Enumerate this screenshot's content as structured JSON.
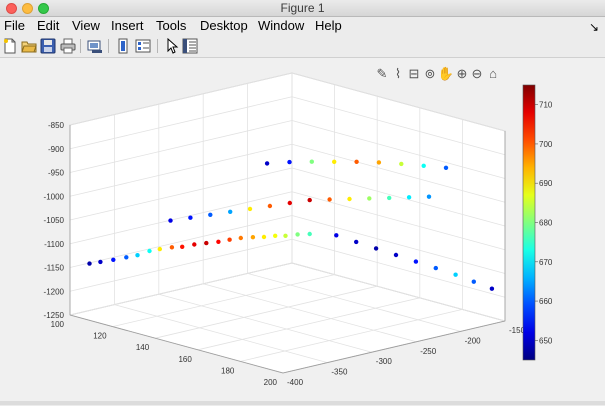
{
  "window": {
    "title": "Figure 1"
  },
  "menu": [
    "File",
    "Edit",
    "View",
    "Insert",
    "Tools",
    "Desktop",
    "Window",
    "Help"
  ],
  "menu_overflow_icon": "arrow-icon",
  "toolbar": {
    "buttons": [
      "new-figure-icon",
      "open-file-icon",
      "save-icon",
      "print-icon",
      "link-plot-icon",
      "insert-colorbar-icon",
      "insert-legend-icon",
      "pointer-icon",
      "property-inspector-icon"
    ]
  },
  "axes_toolbar": [
    "brush-icon",
    "data-tips-icon",
    "export-icon",
    "rotate-3d-icon",
    "pan-icon",
    "zoom-in-icon",
    "zoom-out-icon",
    "home-icon"
  ],
  "chart_data": {
    "type": "scatter",
    "dimensions": "3d",
    "xlim": [
      100,
      200
    ],
    "ylim": [
      -400,
      -150
    ],
    "zlim": [
      -1250,
      -850
    ],
    "x_ticks": [
      "100",
      "120",
      "140",
      "160",
      "180",
      "200"
    ],
    "y_ticks": [
      "-400",
      "-350",
      "-300",
      "-250",
      "-200",
      "-150"
    ],
    "z_ticks": [
      "-850",
      "-900",
      "-950",
      "-1000",
      "-1050",
      "-1100",
      "-1150",
      "-1200",
      "-1250"
    ],
    "colorbar": {
      "ticks": [
        "710",
        "700",
        "690",
        "680",
        "670",
        "660",
        "650"
      ],
      "range": [
        645,
        715
      ],
      "colormap": "jet"
    },
    "grid": true,
    "series": [
      {
        "x": [
          105,
          108,
          112,
          116,
          120,
          124,
          128,
          132,
          136,
          140,
          144,
          148,
          152,
          156,
          160,
          164,
          168,
          172,
          176,
          180
        ],
        "y": [
          -390,
          -385,
          -380,
          -375,
          -372,
          -368,
          -366,
          -362,
          -360,
          -356,
          -352,
          -348,
          -345,
          -342,
          -338,
          -335,
          -332,
          -330,
          -326,
          -322
        ],
        "z": [
          -1140,
          -1135,
          -1128,
          -1120,
          -1112,
          -1100,
          -1092,
          -1085,
          -1080,
          -1072,
          -1066,
          -1060,
          -1052,
          -1045,
          -1040,
          -1036,
          -1030,
          -1026,
          -1020,
          -1016
        ],
        "c": [
          648,
          650,
          655,
          660,
          668,
          672,
          690,
          700,
          705,
          708,
          710,
          706,
          702,
          698,
          695,
          690,
          688,
          685,
          680,
          676
        ]
      },
      {
        "x": [
          118,
          124,
          130,
          136,
          142,
          148,
          154,
          160,
          166,
          172,
          178,
          184,
          190,
          196
        ],
        "y": [
          -330,
          -322,
          -314,
          -306,
          -298,
          -290,
          -282,
          -274,
          -266,
          -258,
          -250,
          -242,
          -234,
          -226
        ],
        "z": [
          -1060,
          -1050,
          -1040,
          -1030,
          -1020,
          -1010,
          -1000,
          -990,
          -985,
          -980,
          -975,
          -970,
          -965,
          -960
        ],
        "c": [
          652,
          655,
          660,
          665,
          690,
          700,
          708,
          710,
          700,
          690,
          682,
          676,
          670,
          664
        ]
      },
      {
        "x": [
          130,
          138,
          146,
          154,
          162,
          170,
          178,
          186,
          194
        ],
        "y": [
          -250,
          -244,
          -238,
          -232,
          -226,
          -220,
          -214,
          -208,
          -202
        ],
        "z": [
          -960,
          -950,
          -942,
          -935,
          -928,
          -922,
          -918,
          -915,
          -912
        ],
        "c": [
          650,
          655,
          680,
          690,
          700,
          695,
          685,
          672,
          660
        ]
      },
      {
        "x": [
          150,
          156,
          162,
          168,
          174,
          180,
          186,
          192,
          198
        ],
        "y": [
          -220,
          -212,
          -204,
          -196,
          -188,
          -180,
          -172,
          -166,
          -160
        ],
        "z": [
          -1100,
          -1110,
          -1120,
          -1130,
          -1140,
          -1150,
          -1160,
          -1170,
          -1180
        ],
        "c": [
          652,
          650,
          648,
          650,
          655,
          660,
          668,
          660,
          650
        ]
      }
    ]
  }
}
